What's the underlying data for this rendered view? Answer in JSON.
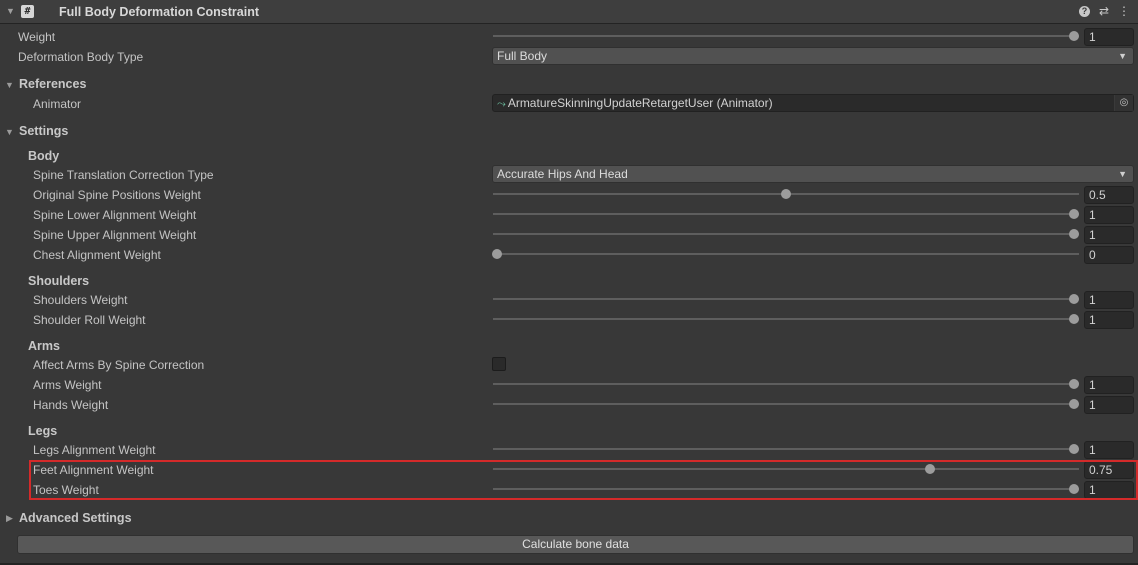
{
  "header": {
    "title": "Full Body Deformation Constraint",
    "script_glyph": "#",
    "help_glyph": "?",
    "preset_glyph": "⇄",
    "menu_glyph": "⋮"
  },
  "weight": {
    "label": "Weight",
    "value": "1",
    "fraction": 1.0
  },
  "body_type": {
    "label": "Deformation Body Type",
    "selected": "Full Body"
  },
  "references": {
    "title": "References",
    "animator_label": "Animator",
    "animator_value": "ArmatureSkinningUpdateRetargetUser (Animator)"
  },
  "settings": {
    "title": "Settings",
    "body": {
      "title": "Body",
      "spine_correction_label": "Spine Translation Correction Type",
      "spine_correction_selected": "Accurate Hips And Head",
      "sliders": [
        {
          "label": "Original Spine Positions Weight",
          "value": "0.5",
          "fraction": 0.5
        },
        {
          "label": "Spine Lower Alignment Weight",
          "value": "1",
          "fraction": 1.0
        },
        {
          "label": "Spine Upper Alignment Weight",
          "value": "1",
          "fraction": 1.0
        },
        {
          "label": "Chest Alignment Weight",
          "value": "0",
          "fraction": 0.0
        }
      ]
    },
    "shoulders": {
      "title": "Shoulders",
      "sliders": [
        {
          "label": "Shoulders Weight",
          "value": "1",
          "fraction": 1.0
        },
        {
          "label": "Shoulder Roll Weight",
          "value": "1",
          "fraction": 1.0
        }
      ]
    },
    "arms": {
      "title": "Arms",
      "affect_label": "Affect Arms By Spine Correction",
      "affect_checked": false,
      "sliders": [
        {
          "label": "Arms Weight",
          "value": "1",
          "fraction": 1.0
        },
        {
          "label": "Hands Weight",
          "value": "1",
          "fraction": 1.0
        }
      ]
    },
    "legs": {
      "title": "Legs",
      "sliders": [
        {
          "label": "Legs Alignment Weight",
          "value": "1",
          "fraction": 1.0
        },
        {
          "label": "Feet Alignment Weight",
          "value": "0.75",
          "fraction": 0.75
        },
        {
          "label": "Toes Weight",
          "value": "1",
          "fraction": 1.0
        }
      ]
    }
  },
  "advanced": {
    "title": "Advanced Settings"
  },
  "calc_button": {
    "label": "Calculate bone data"
  },
  "colors": {
    "highlight": "#d42a2a",
    "background": "#383838"
  }
}
